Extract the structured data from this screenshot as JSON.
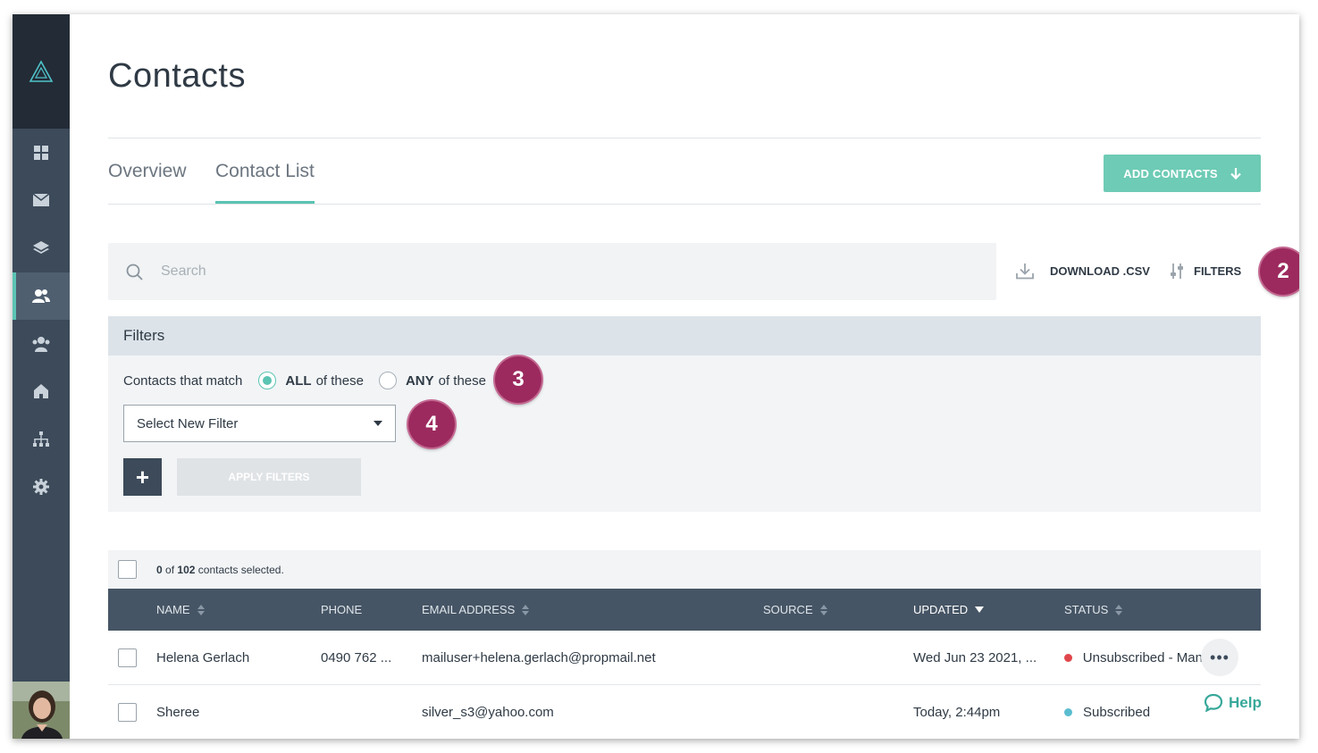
{
  "sidebar": {
    "items": [
      {
        "name": "dashboard",
        "icon": "grid-icon"
      },
      {
        "name": "email",
        "icon": "envelope-icon"
      },
      {
        "name": "layers",
        "icon": "layers-icon"
      },
      {
        "name": "contacts",
        "icon": "users-icon",
        "active": true
      },
      {
        "name": "groups",
        "icon": "group-icon"
      },
      {
        "name": "home",
        "icon": "home-icon"
      },
      {
        "name": "hierarchy",
        "icon": "sitemap-icon"
      },
      {
        "name": "settings",
        "icon": "gear-icon"
      }
    ],
    "accent": "#5bc4b3"
  },
  "page": {
    "title": "Contacts"
  },
  "tabs": [
    {
      "label": "Overview"
    },
    {
      "label": "Contact List",
      "active": true
    }
  ],
  "toolbar": {
    "add_contacts": "ADD CONTACTS",
    "search_placeholder": "Search",
    "download": "DOWNLOAD .CSV",
    "filters": "FILTERS"
  },
  "badges": {
    "b2": "2",
    "b3": "3",
    "b4": "4"
  },
  "filters_panel": {
    "title": "Filters",
    "match_label": "Contacts that match",
    "all_bold": "ALL",
    "all_rest": "of these",
    "any_bold": "ANY",
    "any_rest": "of these",
    "select_value": "Select New Filter",
    "apply": "APPLY FILTERS",
    "plus": "+"
  },
  "selection": {
    "selected": "0",
    "of": "of",
    "total": "102",
    "suffix": "contacts selected."
  },
  "table": {
    "columns": {
      "name": "NAME",
      "phone": "PHONE",
      "email": "EMAIL ADDRESS",
      "source": "SOURCE",
      "updated": "UPDATED",
      "status": "STATUS"
    },
    "rows": [
      {
        "name": "Helena Gerlach",
        "phone": "0490 762 ...",
        "email": "mailuser+helena.gerlach@propmail.net",
        "source": "",
        "updated": "Wed Jun 23 2021, ...",
        "status": "Unsubscribed - Man",
        "status_color": "#e0474c"
      },
      {
        "name": "Sheree",
        "phone": "",
        "email": "silver_s3@yahoo.com",
        "source": "",
        "updated": "Today, 2:44pm",
        "status": "Subscribed",
        "status_color": "#5bbdd0"
      }
    ]
  },
  "help": {
    "label": "Help"
  },
  "colors": {
    "primary": "#6ecbb5",
    "badge": "#9c2a5e",
    "header": "#465565"
  }
}
